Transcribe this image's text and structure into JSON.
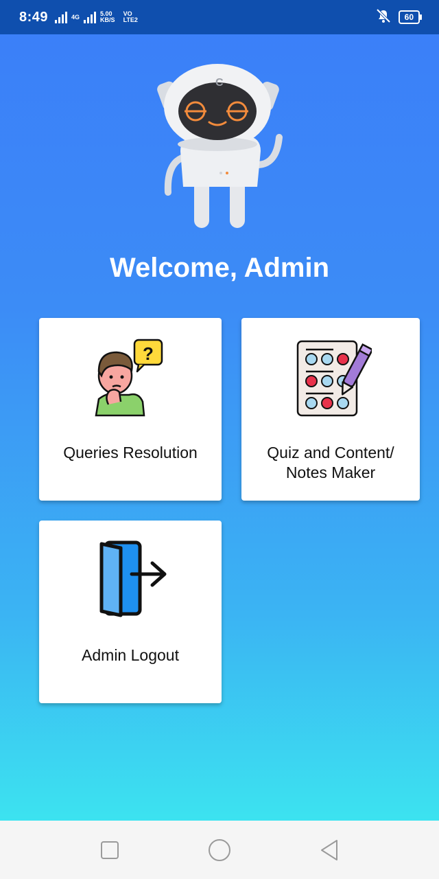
{
  "status_bar": {
    "time": "8:49",
    "net_speed_top": "5.00",
    "net_speed_unit": "KB/S",
    "net_type": "4G",
    "volte_top": "VO",
    "volte_bottom": "LTE2",
    "battery": "60",
    "icons": [
      "signal-icon",
      "signal-icon",
      "mute-icon",
      "battery-icon"
    ]
  },
  "welcome": {
    "title": "Welcome, Admin"
  },
  "mascot": {
    "icon": "robot-mascot",
    "badge_letter": "C"
  },
  "cards": {
    "queries": {
      "label": "Queries Resolution",
      "icon": "thinking-person-question-icon"
    },
    "quiz": {
      "label_line1": "Quiz and Content/",
      "label_line2": "Notes Maker",
      "icon": "quiz-sheet-pen-icon"
    },
    "logout": {
      "label": "Admin Logout",
      "icon": "door-exit-icon"
    }
  },
  "nav": {
    "icons": [
      "recents-square-icon",
      "home-circle-icon",
      "back-triangle-icon"
    ]
  },
  "colors": {
    "status_bar": "#0f4fae",
    "gradient_top": "#3b7ef9",
    "gradient_bottom": "#3cf0ef",
    "card": "#ffffff"
  }
}
